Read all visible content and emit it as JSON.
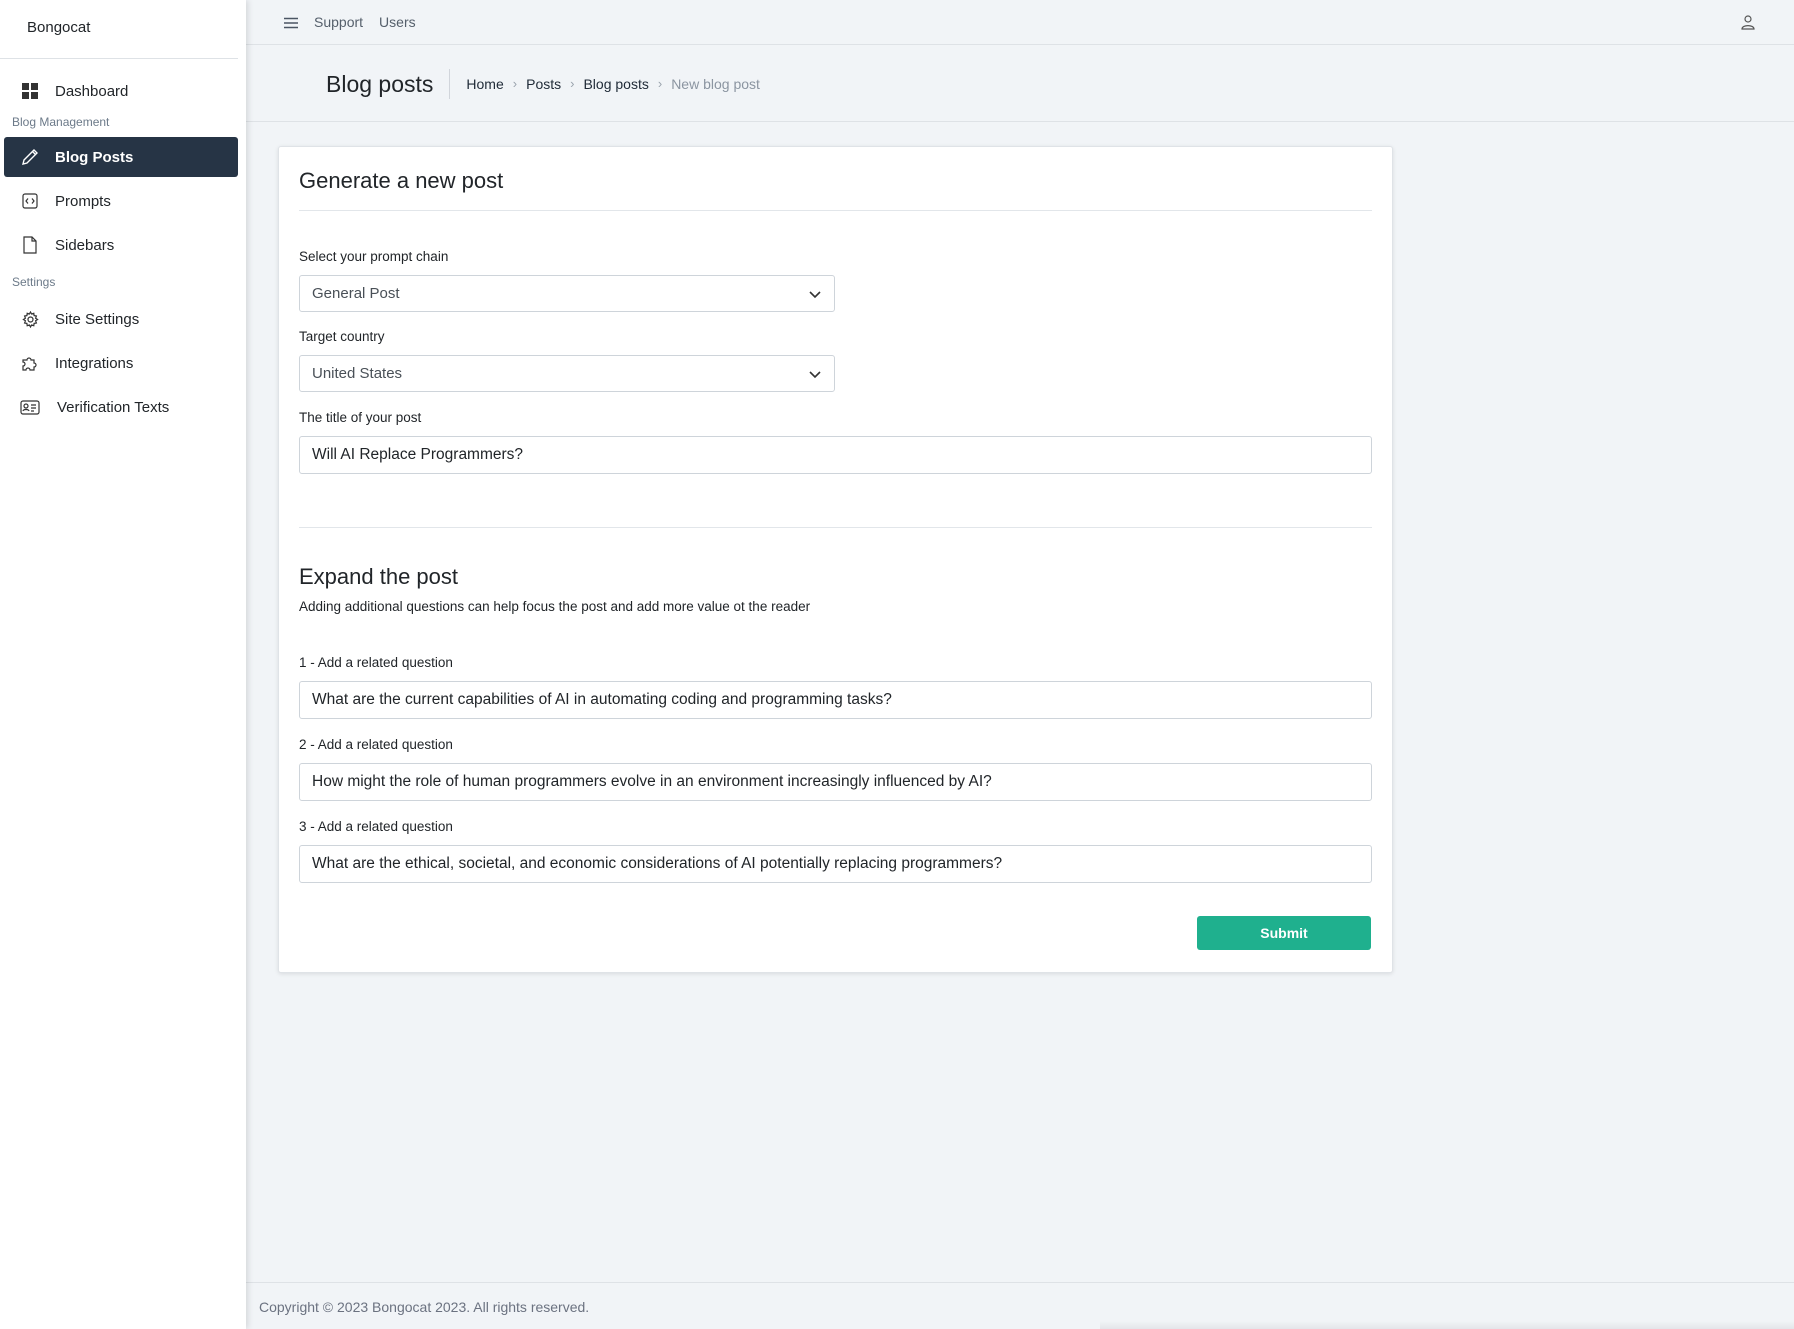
{
  "brand": "Bongocat",
  "sidebar": {
    "dashboard": {
      "label": "Dashboard",
      "icon": "dashboard-icon"
    },
    "section_blog": "Blog Management",
    "blog_posts": {
      "label": "Blog Posts",
      "icon": "pencil-icon"
    },
    "prompts": {
      "label": "Prompts",
      "icon": "code-icon"
    },
    "sidebars": {
      "label": "Sidebars",
      "icon": "file-icon"
    },
    "section_settings": "Settings",
    "site_settings": {
      "label": "Site Settings",
      "icon": "gear-icon"
    },
    "integrations": {
      "label": "Integrations",
      "icon": "puzzle-icon"
    },
    "verification_texts": {
      "label": "Verification Texts",
      "icon": "id-card-icon"
    }
  },
  "topbar": {
    "support": "Support",
    "users": "Users"
  },
  "header": {
    "title": "Blog posts",
    "breadcrumb": [
      "Home",
      "Posts",
      "Blog posts",
      "New blog post"
    ]
  },
  "form": {
    "heading": "Generate a new post",
    "prompt_chain_label": "Select your prompt chain",
    "prompt_chain_value": "General Post",
    "country_label": "Target country",
    "country_value": "United States",
    "title_label": "The title of your post",
    "title_value": "Will AI Replace Programmers?",
    "expand_heading": "Expand the post",
    "expand_desc": "Adding additional questions can help focus the post and add more value ot the reader",
    "questions": [
      {
        "label": "1 - Add a related question",
        "value": "What are the current capabilities of AI in automating coding and programming tasks?"
      },
      {
        "label": "2 - Add a related question",
        "value": "How might the role of human programmers evolve in an environment increasingly influenced by AI?"
      },
      {
        "label": "3 - Add a related question",
        "value": "What are the ethical, societal, and economic considerations of AI potentially replacing programmers?"
      }
    ],
    "submit_label": "Submit"
  },
  "footer": "Copyright © 2023 Bongocat 2023. All rights reserved.",
  "colors": {
    "active_nav": "#263445",
    "submit": "#1fb08e",
    "background": "#f1f4f7"
  }
}
